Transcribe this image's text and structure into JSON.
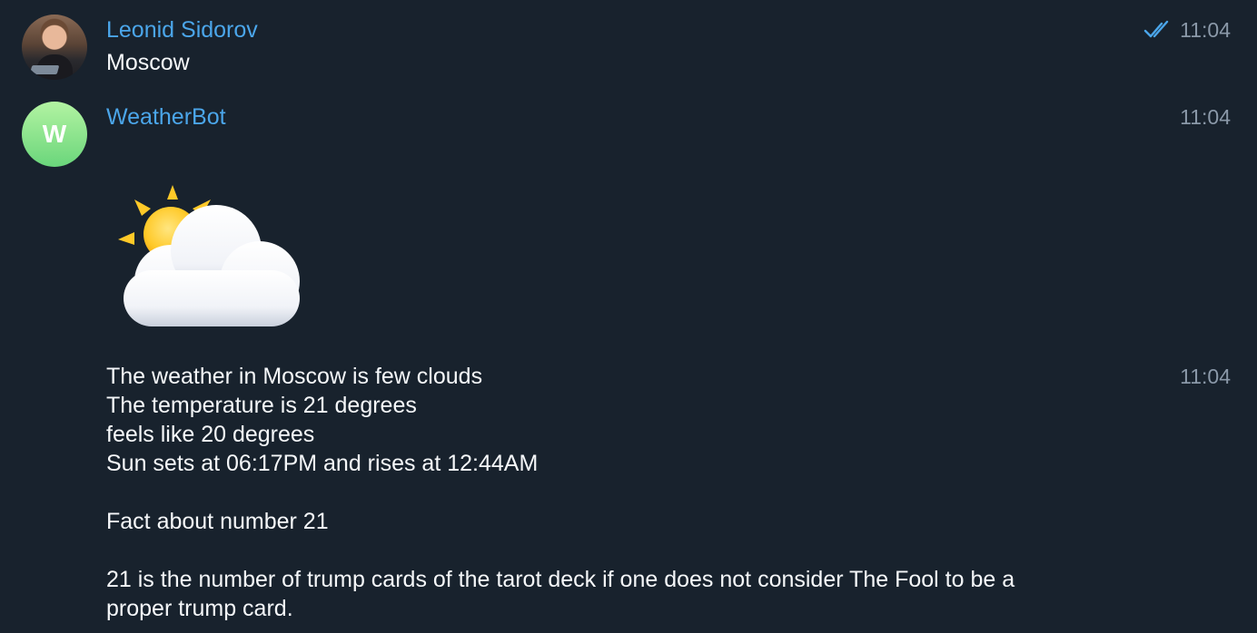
{
  "messages": [
    {
      "sender": "Leonid Sidorov",
      "text": "Moscow",
      "time": "11:04",
      "status_icon": "double-check-icon"
    },
    {
      "sender": "WeatherBot",
      "avatar_letter": "W",
      "time": "11:04",
      "sticker": "sun-behind-cloud-icon"
    },
    {
      "text": "The weather in Moscow is few clouds\nThe temperature is 21 degrees\nfeels like 20 degrees\nSun sets at 06:17PM and rises at 12:44AM\n\nFact about number 21\n\n21 is the number of trump cards of the tarot deck if one does not consider The Fool to be a\nproper trump card.",
      "time": "11:04"
    }
  ],
  "colors": {
    "background": "#18222d",
    "sender_name": "#4ba6ea",
    "time": "#8a98a8",
    "check": "#4ba6ea",
    "bot_avatar": "#7fe08a"
  }
}
